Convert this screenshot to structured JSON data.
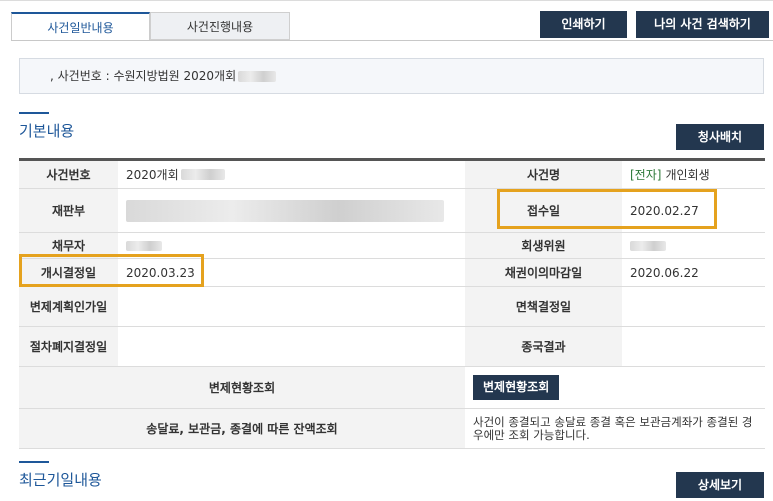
{
  "tabs": {
    "general": "사건일반내용",
    "progress": "사건진행내용"
  },
  "buttons": {
    "print": "인쇄하기",
    "my_case_search": "나의 사건 검색하기",
    "sasbae": "청사배치",
    "repayment_lookup": "변제현황조회",
    "detail": "상세보기"
  },
  "case_header": {
    "text": ", 사건번호 : 수원지방법원 2020개회"
  },
  "sections": {
    "basic": "기본내용",
    "recent": "최근기일내용"
  },
  "table": {
    "case_number_label": "사건번호",
    "case_number_value": "2020개회",
    "case_name_label": "사건명",
    "case_name_tag": "[전자]",
    "case_name_value": "개인회생",
    "court_label": "재판부",
    "receipt_label": "접수일",
    "receipt_value": "2020.02.27",
    "debtor_label": "채무자",
    "commissioner_label": "회생위원",
    "start_label": "개시결정일",
    "start_value": "2020.03.23",
    "claim_deadline_label": "채권이의마감일",
    "claim_deadline_value": "2020.06.22",
    "repayment_plan_label": "변제계획인가일",
    "discharge_label": "면책결정일",
    "abolish_label": "절차폐지결정일",
    "final_result_label": "종국결과",
    "repayment_status_label": "변제현황조회",
    "balance_label": "송달료, 보관금, 종결에 따른 잔액조회",
    "balance_note": "사건이 종결되고 송달료 종결 혹은 보관금계좌가 종결된 경우에만 조회 가능합니다."
  }
}
